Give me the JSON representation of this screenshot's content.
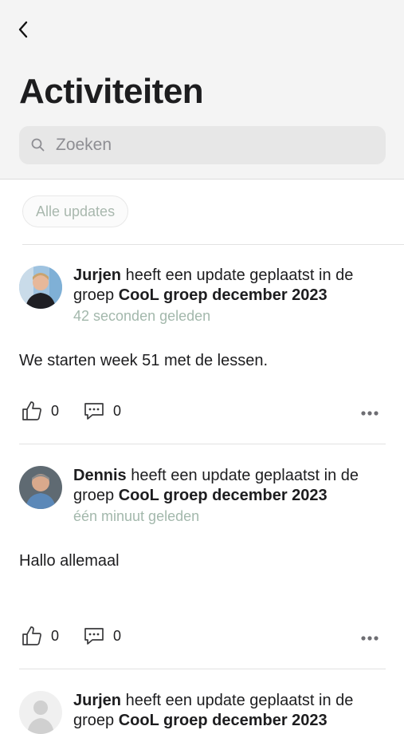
{
  "header": {
    "title": "Activiteiten",
    "search_placeholder": "Zoeken"
  },
  "filter": {
    "label": "Alle updates"
  },
  "posts": [
    {
      "author": "Jurjen",
      "action": " heeft een update geplaatst in de groep ",
      "group": "CooL groep december 2023",
      "time": "42 seconden geleden",
      "body": "We starten week 51 met de lessen.",
      "likes": "0",
      "comments": "0"
    },
    {
      "author": "Dennis",
      "action": " heeft een update geplaatst in de groep ",
      "group": "CooL groep december 2023",
      "time": "één minuut geleden",
      "body": "Hallo allemaal",
      "likes": "0",
      "comments": "0"
    },
    {
      "author": "Jurjen",
      "action": " heeft een update geplaatst in de groep ",
      "group": "CooL groep december 2023"
    }
  ],
  "colors": {
    "accent_muted": "#a3b8ac",
    "header_bg": "#f4f4f4",
    "search_bg": "#e7e7e7"
  },
  "icons": [
    "back-icon",
    "search-icon",
    "like-icon",
    "comment-icon",
    "more-icon",
    "avatar-placeholder-icon"
  ]
}
